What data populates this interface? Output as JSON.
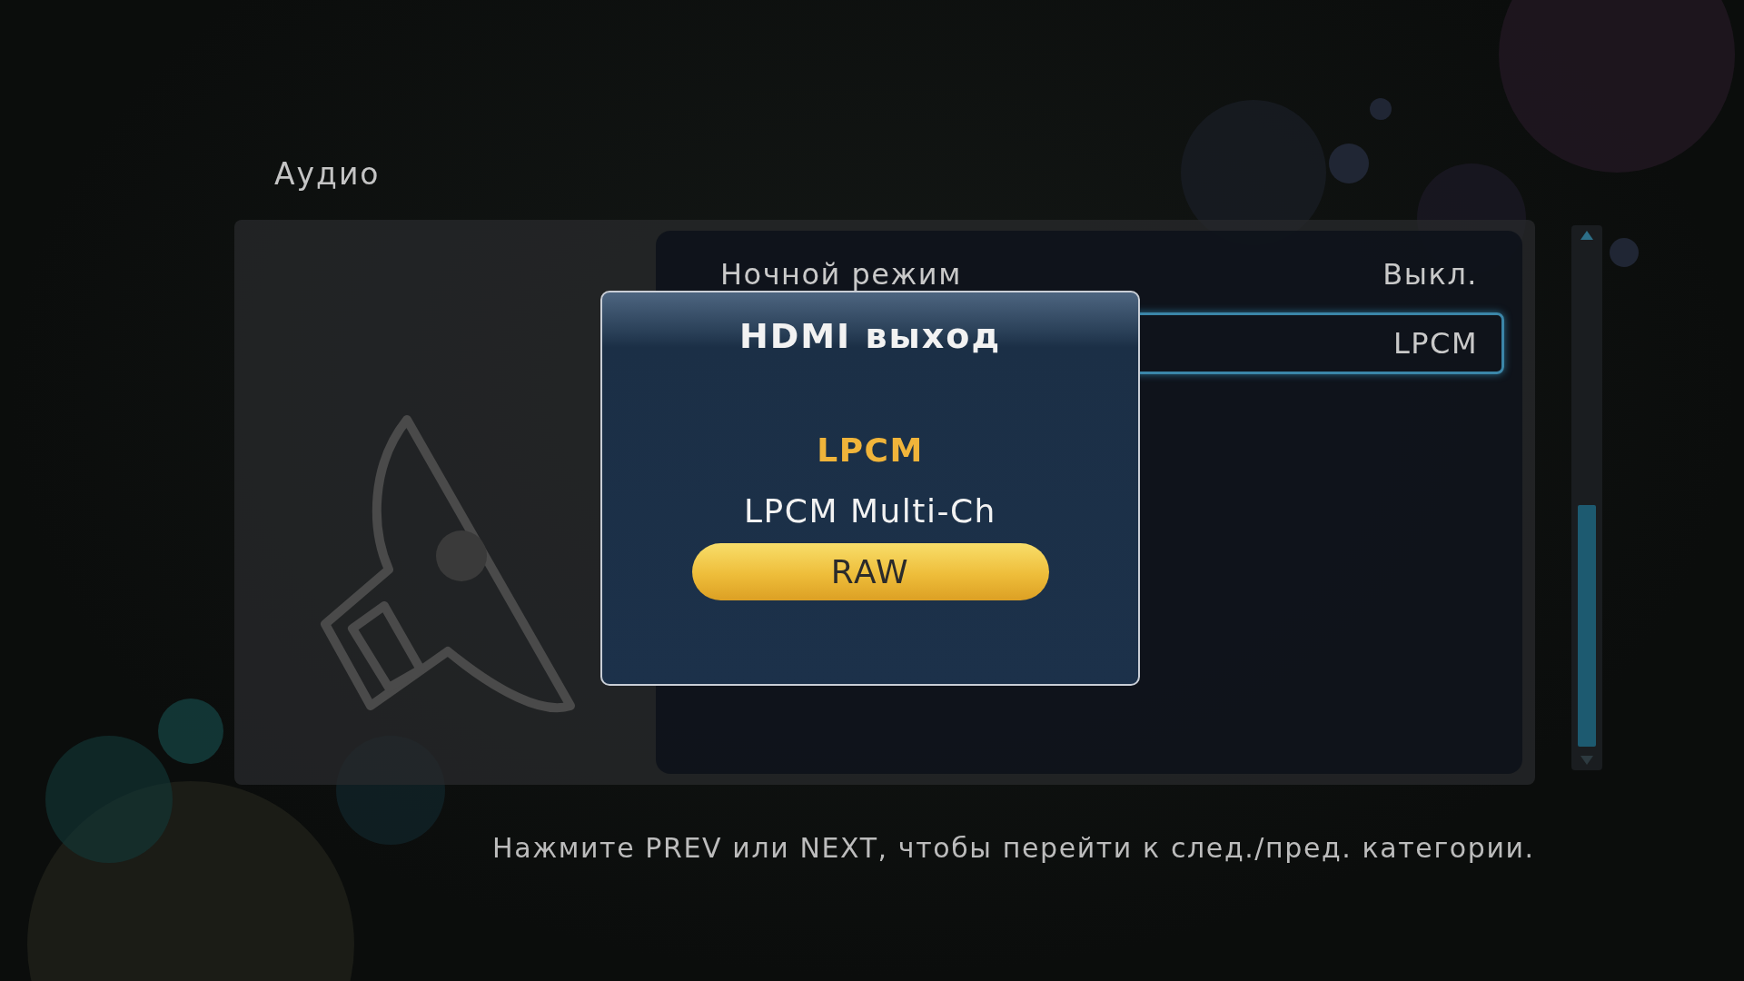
{
  "section_title": "Аудио",
  "settings": [
    {
      "label": "Ночной режим",
      "value": "Выкл.",
      "selected": false
    },
    {
      "value": "LPCM",
      "selected": true
    }
  ],
  "dialog": {
    "title": "HDMI выход",
    "options": [
      {
        "label": "LPCM",
        "current": true,
        "selected": false
      },
      {
        "label": "LPCM Multi-Ch",
        "current": false,
        "selected": false
      },
      {
        "label": "RAW",
        "current": false,
        "selected": true
      }
    ]
  },
  "hint": "Нажмите PREV или NEXT, чтобы перейти к след./пред. категории."
}
